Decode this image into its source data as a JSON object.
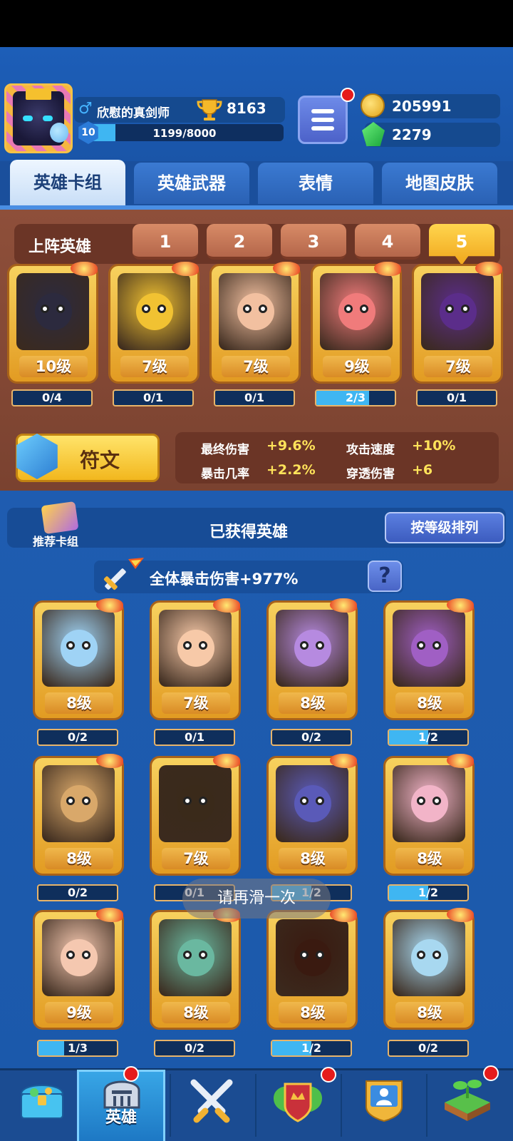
{
  "header": {
    "player_name": "欣慰的真剑师",
    "gender_icon": "male-icon",
    "trophies": "8163",
    "level": "10",
    "xp_text": "1199/8000",
    "xp_fraction": 0.15,
    "gold": "205991",
    "gems": "2279"
  },
  "tabs": [
    {
      "label": "英雄卡组",
      "active": true
    },
    {
      "label": "英雄武器",
      "active": false
    },
    {
      "label": "表情",
      "active": false
    },
    {
      "label": "地图皮肤",
      "active": false
    }
  ],
  "lineup": {
    "title": "上阵英雄",
    "deck_tabs": [
      "1",
      "2",
      "3",
      "4",
      "5"
    ],
    "active_deck": "5",
    "heroes": [
      {
        "level": "10级",
        "progress": "0/4",
        "fill": 0,
        "color": "#2c2a3e"
      },
      {
        "level": "7级",
        "progress": "0/1",
        "fill": 0,
        "color": "#f1c232"
      },
      {
        "level": "7级",
        "progress": "0/1",
        "fill": 0,
        "color": "#f2c0a0"
      },
      {
        "level": "9级",
        "progress": "2/3",
        "fill": 0.67,
        "color": "#f07b7b"
      },
      {
        "level": "7级",
        "progress": "0/1",
        "fill": 0,
        "color": "#5b2d8a"
      }
    ]
  },
  "rune": {
    "label": "符文",
    "stats": [
      {
        "label": "最终伤害",
        "value": "+9.6%"
      },
      {
        "label": "攻击速度",
        "value": "+10%"
      },
      {
        "label": "暴击几率",
        "value": "+2.2%"
      },
      {
        "label": "穿透伤害",
        "value": "+6"
      }
    ]
  },
  "collection": {
    "recommend_label": "推荐卡组",
    "title": "已获得英雄",
    "sort_label": "按等级排列",
    "crit_text": "全体暴击伤害+977%",
    "help_label": "?",
    "heroes": [
      {
        "level": "8级",
        "progress": "0/2",
        "fill": 0,
        "color": "#9fd3f5"
      },
      {
        "level": "7级",
        "progress": "0/1",
        "fill": 0,
        "color": "#f7c9a8"
      },
      {
        "level": "8级",
        "progress": "0/2",
        "fill": 0,
        "color": "#b68ae0"
      },
      {
        "level": "8级",
        "progress": "1/2",
        "fill": 0.5,
        "color": "#a05fc4"
      },
      {
        "level": "8级",
        "progress": "0/2",
        "fill": 0,
        "color": "#d9a86a"
      },
      {
        "level": "7级",
        "progress": "0/1",
        "fill": 0,
        "color": "#3a2a1a"
      },
      {
        "level": "8级",
        "progress": "1/2",
        "fill": 0.5,
        "color": "#5a5ab8"
      },
      {
        "level": "8级",
        "progress": "1/2",
        "fill": 0.5,
        "color": "#f2b4c8"
      },
      {
        "level": "9级",
        "progress": "1/3",
        "fill": 0.33,
        "color": "#f5c8b0"
      },
      {
        "level": "8级",
        "progress": "0/2",
        "fill": 0,
        "color": "#6ab8a0"
      },
      {
        "level": "8级",
        "progress": "1/2",
        "fill": 0.5,
        "color": "#3a1a10"
      },
      {
        "level": "8级",
        "progress": "0/2",
        "fill": 0,
        "color": "#a8d8f0"
      }
    ]
  },
  "toast": "请再滑一次",
  "bottom_nav": [
    {
      "icon": "treasure-chest-icon",
      "label": "",
      "active": false,
      "dot": false
    },
    {
      "icon": "helmet-icon",
      "label": "英雄",
      "active": true,
      "dot": true
    },
    {
      "icon": "crossed-swords-icon",
      "label": "",
      "active": false,
      "dot": false
    },
    {
      "icon": "crown-shield-icon",
      "label": "",
      "active": false,
      "dot": true
    },
    {
      "icon": "team-icon",
      "label": "",
      "active": false,
      "dot": false
    },
    {
      "icon": "sprout-island-icon",
      "label": "",
      "active": false,
      "dot": true
    }
  ]
}
